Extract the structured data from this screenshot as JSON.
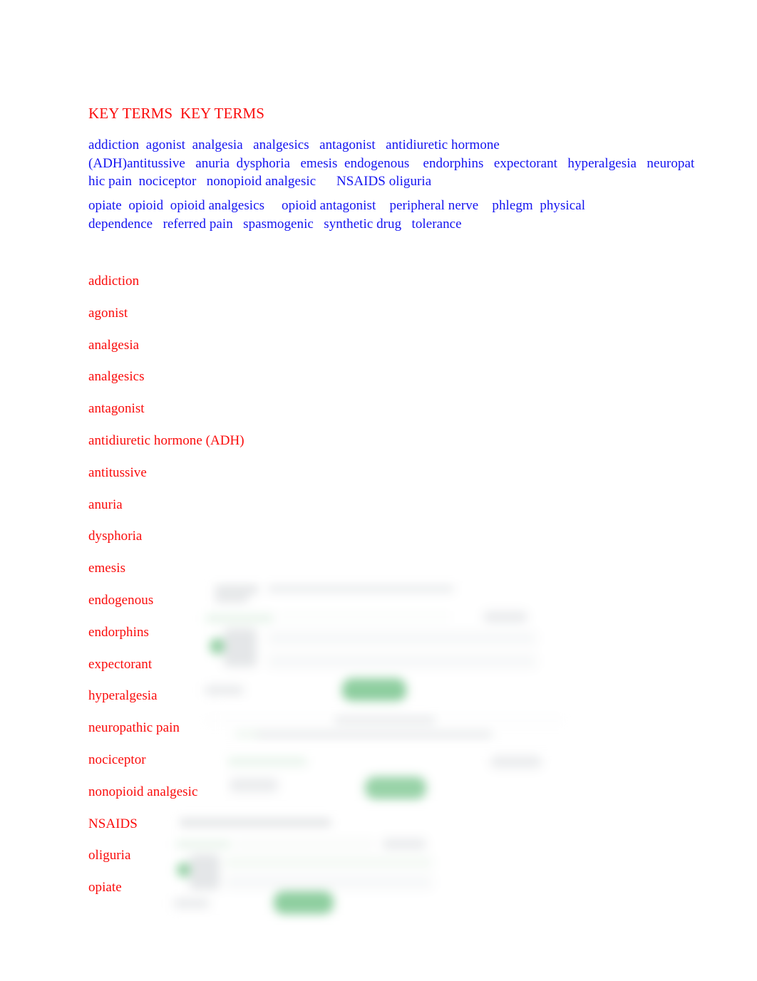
{
  "document": {
    "heading": "KEY TERMS  KEY TERMS",
    "heading_color": "#fa0b0b",
    "terms_color": "#1414f0",
    "list_color": "#fa0b0b",
    "background_color": "#ffffff"
  },
  "key_terms_paragraph_1": [
    "addiction",
    "agonist",
    "analgesia",
    "analgesics",
    "antagonist",
    "antidiuretic hormone (ADH)",
    "antitussive",
    "anuria",
    "dysphoria",
    "emesis",
    "endogenous",
    "endorphins",
    "expectorant",
    "hyperalgesia",
    "neuropathic pain",
    "nociceptor",
    "nonopioid analgesic",
    "NSAIDS",
    "oliguria"
  ],
  "key_terms_paragraph_1_lines": [
    "addiction  agonist  analgesia   analgesics   antagonist   antidiuretic hormone",
    "(ADH)antitussive   anuria  dysphoria   emesis  endogenous    endorphins   expectorant   hyperalgesia   neuropat",
    "hic pain  nociceptor   nonopioid analgesic      NSAIDS oliguria"
  ],
  "key_terms_paragraph_2": [
    "opiate",
    "opioid",
    "opioid analgesics",
    "opioid antagonist",
    "peripheral nerve",
    "phlegm",
    "physical dependence",
    "referred pain",
    "spasmogenic",
    "synthetic drug",
    "tolerance"
  ],
  "key_terms_paragraph_2_lines": [
    "opiate  opioid  opioid analgesics     opioid antagonist    peripheral nerve    phlegm  physical",
    "dependence   referred pain   spasmogenic   synthetic drug   tolerance"
  ],
  "term_list": [
    "addiction",
    "agonist",
    "analgesia",
    "analgesics",
    "antagonist",
    "antidiuretic hormone (ADH)",
    "antitussive",
    "anuria",
    "dysphoria",
    "emesis",
    "endogenous",
    "endorphins",
    "expectorant",
    "hyperalgesia",
    "neuropathic pain",
    "nociceptor",
    "nonopioid analgesic",
    "NSAIDS",
    "oliguria",
    "opiate"
  ],
  "obscured_overlay": {
    "description": "heavily blurred, unreadable pasted interface panels overlapping the lower-right of the page",
    "accent_color": "#34a853",
    "chip_color": "#d9dcdf",
    "panel_background": "#ffffff"
  }
}
